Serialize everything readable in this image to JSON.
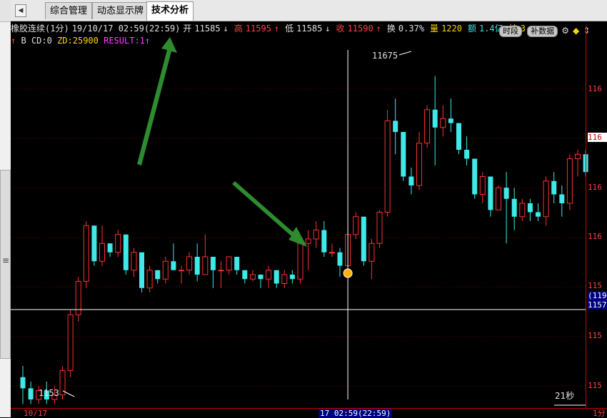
{
  "tabs": {
    "items": [
      "综合管理",
      "动态显示牌",
      "技术分析"
    ],
    "active_index": 2
  },
  "info": {
    "symbol": "橡胶连续(1分)",
    "datetime": "19/10/17 02:59(22:59)",
    "open_label": "开",
    "open": "11585",
    "high_label": "高",
    "high": "11595",
    "low_label": "低",
    "low": "11585",
    "close_label": "收",
    "close": "11590",
    "turnover_label": "换",
    "turnover": "0.37%",
    "volume_label": "量",
    "volume": "1220",
    "amount_label": "额",
    "amount": "1.4亿",
    "position_label": "持",
    "position": "3",
    "btn_period": "时段",
    "btn_fill": "补数据"
  },
  "indicator": {
    "prefix": "B",
    "cd": "CD:0",
    "zd": "ZD:25900",
    "result": "RESULT:1"
  },
  "price_axis": {
    "labels": [
      "116",
      "116",
      "116",
      "116",
      "115",
      "115",
      "115"
    ],
    "cur_label": "116",
    "tag1": "(119",
    "tag2": "1157"
  },
  "annotations": {
    "max_label": "11675",
    "min_label": "1153",
    "countdown": "21秒",
    "crosshair_time": "17 02:59(22:59)",
    "left_date": "10/17",
    "right_label": "1分"
  },
  "chart_data": {
    "type": "candlestick",
    "ylim": [
      11530,
      11690
    ],
    "candles": [
      [
        11540,
        11545,
        11528,
        11535
      ],
      [
        11535,
        11538,
        11528,
        11530
      ],
      [
        11530,
        11536,
        11528,
        11534
      ],
      [
        11534,
        11538,
        11528,
        11530
      ],
      [
        11530,
        11536,
        11528,
        11532
      ],
      [
        11532,
        11545,
        11530,
        11543
      ],
      [
        11543,
        11570,
        11540,
        11568
      ],
      [
        11568,
        11585,
        11565,
        11583
      ],
      [
        11583,
        11610,
        11580,
        11608
      ],
      [
        11608,
        11608,
        11590,
        11592
      ],
      [
        11592,
        11608,
        11590,
        11600
      ],
      [
        11600,
        11600,
        11594,
        11596
      ],
      [
        11596,
        11606,
        11594,
        11604
      ],
      [
        11604,
        11604,
        11586,
        11588
      ],
      [
        11588,
        11598,
        11585,
        11596
      ],
      [
        11596,
        11596,
        11578,
        11580
      ],
      [
        11580,
        11590,
        11578,
        11588
      ],
      [
        11588,
        11588,
        11582,
        11584
      ],
      [
        11584,
        11594,
        11582,
        11592
      ],
      [
        11592,
        11600,
        11590,
        11588
      ],
      [
        11588,
        11590,
        11582,
        11588
      ],
      [
        11588,
        11596,
        11586,
        11594
      ],
      [
        11594,
        11600,
        11583,
        11586
      ],
      [
        11586,
        11604,
        11586,
        11594
      ],
      [
        11594,
        11594,
        11580,
        11588
      ],
      [
        11588,
        11592,
        11580,
        11588
      ],
      [
        11588,
        11594,
        11586,
        11594
      ],
      [
        11594,
        11594,
        11586,
        11588
      ],
      [
        11588,
        11588,
        11582,
        11584
      ],
      [
        11584,
        11588,
        11583,
        11586
      ],
      [
        11586,
        11586,
        11580,
        11584
      ],
      [
        11584,
        11590,
        11580,
        11588
      ],
      [
        11588,
        11588,
        11580,
        11582
      ],
      [
        11582,
        11588,
        11580,
        11586
      ],
      [
        11586,
        11588,
        11582,
        11584
      ],
      [
        11584,
        11602,
        11582,
        11600
      ],
      [
        11600,
        11606,
        11588,
        11602
      ],
      [
        11602,
        11610,
        11598,
        11606
      ],
      [
        11606,
        11610,
        11594,
        11596
      ],
      [
        11596,
        11600,
        11594,
        11596
      ],
      [
        11596,
        11598,
        11585,
        11590
      ],
      [
        11590,
        11606,
        11590,
        11604
      ],
      [
        11604,
        11614,
        11602,
        11612
      ],
      [
        11612,
        11612,
        11590,
        11592
      ],
      [
        11592,
        11602,
        11584,
        11600
      ],
      [
        11600,
        11615,
        11598,
        11614
      ],
      [
        11614,
        11660,
        11612,
        11655
      ],
      [
        11655,
        11665,
        11640,
        11650
      ],
      [
        11650,
        11650,
        11628,
        11630
      ],
      [
        11630,
        11634,
        11622,
        11626
      ],
      [
        11626,
        11650,
        11624,
        11645
      ],
      [
        11645,
        11662,
        11643,
        11660
      ],
      [
        11660,
        11675,
        11635,
        11652
      ],
      [
        11652,
        11662,
        11648,
        11656
      ],
      [
        11656,
        11665,
        11650,
        11654
      ],
      [
        11654,
        11654,
        11640,
        11642
      ],
      [
        11642,
        11648,
        11635,
        11638
      ],
      [
        11638,
        11638,
        11620,
        11622
      ],
      [
        11622,
        11632,
        11618,
        11630
      ],
      [
        11630,
        11630,
        11612,
        11615
      ],
      [
        11615,
        11626,
        11615,
        11625
      ],
      [
        11625,
        11632,
        11600,
        11620
      ],
      [
        11620,
        11625,
        11606,
        11612
      ],
      [
        11612,
        11620,
        11610,
        11618
      ],
      [
        11618,
        11620,
        11610,
        11614
      ],
      [
        11614,
        11618,
        11610,
        11612
      ],
      [
        11612,
        11630,
        11608,
        11628
      ],
      [
        11628,
        11632,
        11618,
        11622
      ],
      [
        11622,
        11626,
        11612,
        11618
      ],
      [
        11618,
        11640,
        11615,
        11638
      ],
      [
        11638,
        11642,
        11630,
        11640
      ],
      [
        11640,
        11642,
        11630,
        11632
      ]
    ],
    "crosshair_index": 41,
    "crosshair_value": 11590
  }
}
